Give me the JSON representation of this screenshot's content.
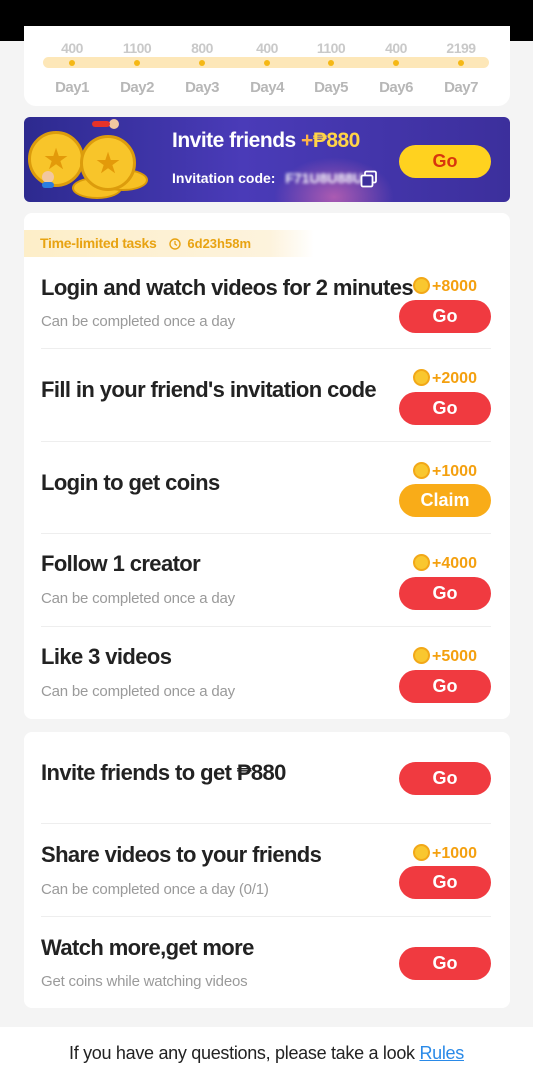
{
  "checkin": {
    "days": [
      {
        "amount": "400",
        "label": "Day1"
      },
      {
        "amount": "1100",
        "label": "Day2"
      },
      {
        "amount": "800",
        "label": "Day3"
      },
      {
        "amount": "400",
        "label": "Day4"
      },
      {
        "amount": "1100",
        "label": "Day5"
      },
      {
        "amount": "400",
        "label": "Day6"
      },
      {
        "amount": "2199",
        "label": "Day7"
      }
    ]
  },
  "banner": {
    "title_prefix": "Invite friends",
    "title_plus": "+",
    "title_amount": "₱880",
    "code_label": "Invitation code:",
    "code_value": "F71U8U88U",
    "button": "Go"
  },
  "section": {
    "title": "Time-limited tasks",
    "timer": "6d23h58m"
  },
  "tasks": [
    {
      "title": "Login and watch videos for 2 minutes",
      "subtitle": "Can be completed once a day",
      "reward": "+8000",
      "button": "Go"
    },
    {
      "title": "Fill in your friend's invitation code",
      "subtitle": "",
      "reward": "+2000",
      "button": "Go"
    },
    {
      "title": "Login to get coins",
      "subtitle": "",
      "reward": "+1000",
      "button": "Claim"
    },
    {
      "title": "Follow 1 creator",
      "subtitle": "Can be completed once a day",
      "reward": "+4000",
      "button": "Go"
    },
    {
      "title": "Like 3 videos",
      "subtitle": "Can be completed once a day",
      "reward": "+5000",
      "button": "Go"
    }
  ],
  "tasks2": [
    {
      "title": "Invite friends to get ₱880",
      "subtitle": "",
      "reward": "",
      "button": "Go"
    },
    {
      "title": "Share videos to your friends",
      "subtitle": "Can be completed once a day (0/1)",
      "reward": "+1000",
      "button": "Go"
    },
    {
      "title": "Watch more,get more",
      "subtitle": "Get coins while watching videos",
      "reward": "",
      "button": "Go"
    }
  ],
  "footer": {
    "text": "If you have any questions, please take a look",
    "link": "Rules"
  },
  "colors": {
    "accent_red": "#f03a40",
    "accent_orange": "#f9ac18",
    "coin_gold": "#f4a00f",
    "banner_purple": "#3c2f9c",
    "link_blue": "#2a8ae8"
  }
}
